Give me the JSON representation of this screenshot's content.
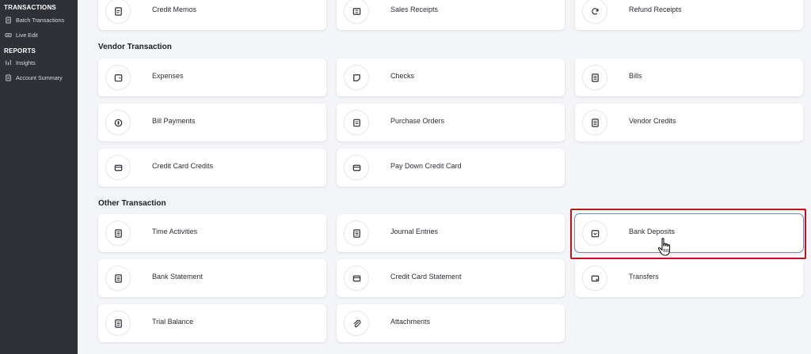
{
  "sidebar": {
    "transactions_heading": "TRANSACTIONS",
    "reports_heading": "REPORTS",
    "items": [
      {
        "label": "Batch Transactions",
        "icon": "document-icon"
      },
      {
        "label": "Live Edit",
        "icon": "edit-icon"
      },
      {
        "label": "Insights",
        "icon": "insights-icon"
      },
      {
        "label": "Account Summary",
        "icon": "document-icon"
      }
    ]
  },
  "sections": {
    "vendor_title": "Vendor Transaction",
    "other_title": "Other Transaction"
  },
  "cards": {
    "credit_memos": "Credit Memos",
    "sales_receipts": "Sales Receipts",
    "refund_receipts": "Refund Receipts",
    "expenses": "Expenses",
    "checks": "Checks",
    "bills": "Bills",
    "bill_payments": "Bill Payments",
    "purchase_orders": "Purchase Orders",
    "vendor_credits": "Vendor Credits",
    "credit_card_credits": "Credit Card Credits",
    "pay_down_credit_card": "Pay Down Credit Card",
    "time_activities": "Time Activities",
    "journal_entries": "Journal Entries",
    "bank_deposits": "Bank Deposits",
    "bank_statement": "Bank Statement",
    "credit_card_statement": "Credit Card Statement",
    "transfers": "Transfers",
    "trial_balance": "Trial Balance",
    "attachments": "Attachments"
  },
  "colors": {
    "sidebar_bg": "#2f3137",
    "page_bg": "#f4f5f8",
    "highlight": "#c0141c",
    "hover_border": "#7a87b7"
  }
}
